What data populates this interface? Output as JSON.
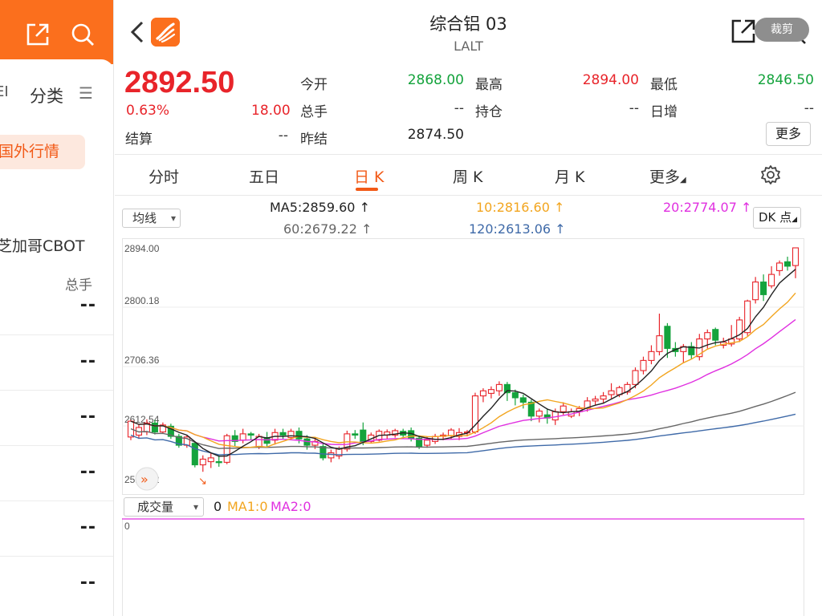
{
  "left": {
    "tab_cut": "EI",
    "tab_label": "分类",
    "menu_glyph": "☰",
    "pill_label": "国外行情",
    "market_name": "芝加哥CBOT",
    "col_header": "总手",
    "rows": [
      "--",
      "--",
      "--",
      "--",
      "--",
      "--"
    ]
  },
  "header": {
    "title": "综合铝 03",
    "subtitle": "LALT",
    "crop_label": "裁剪"
  },
  "quote": {
    "price": "2892.50",
    "change_pct": "0.63%",
    "change": "18.00",
    "settle_label": "结算",
    "settle_value": "--",
    "open_label": "今开",
    "open_value": "2868.00",
    "volume_label": "总手",
    "volume_value": "--",
    "prev_label": "昨结",
    "prev_value": "2874.50",
    "high_label": "最高",
    "high_value": "2894.00",
    "oi_label": "持仓",
    "oi_value": "--",
    "low_label": "最低",
    "low_value": "2846.50",
    "daily_inc_label": "日增",
    "daily_inc_value": "--",
    "more_label": "更多"
  },
  "tabs": [
    "分时",
    "五日",
    "日 K",
    "周 K",
    "月 K",
    "更多"
  ],
  "active_tab": "日 K",
  "indicators": {
    "selector": "均线",
    "ma5": "MA5:2859.60 ↑",
    "ma10": "10:2816.60 ↑",
    "ma20": "20:2774.07 ↑",
    "ma60": "60:2679.22 ↑",
    "ma120": "120:2613.06 ↑",
    "dk_label": "DK 点"
  },
  "colors": {
    "up": "#e8242a",
    "down": "#14a33c",
    "accent": "#f25a17",
    "ma5": "#222222",
    "ma10": "#f2a51f",
    "ma20": "#e030e0",
    "ma60": "#666666",
    "ma120": "#3f6aa8"
  },
  "volume": {
    "selector": "成交量",
    "value": "0",
    "ma1": "MA1:0",
    "ma2": "MA2:0",
    "axis_zero": "0"
  },
  "chart_data": {
    "type": "candlestick",
    "y_ticks": [
      "2894.00",
      "2800.18",
      "2706.36",
      "2612.54",
      "2518.72"
    ],
    "ylim": [
      2518.72,
      2894.0
    ],
    "candles": [
      [
        2595,
        2620,
        2590,
        2622
      ],
      [
        2598,
        2610,
        2592,
        2615
      ],
      [
        2603,
        2617,
        2598,
        2623
      ],
      [
        2617,
        2603,
        2599,
        2622
      ],
      [
        2603,
        2614,
        2600,
        2618
      ],
      [
        2612,
        2596,
        2592,
        2616
      ],
      [
        2596,
        2582,
        2578,
        2600
      ],
      [
        2582,
        2595,
        2578,
        2598
      ],
      [
        2585,
        2551,
        2547,
        2588
      ],
      [
        2551,
        2560,
        2540,
        2566
      ],
      [
        2556,
        2562,
        2546,
        2570
      ],
      [
        2556,
        2555,
        2548,
        2566
      ],
      [
        2555,
        2597,
        2552,
        2600
      ],
      [
        2597,
        2588,
        2580,
        2606
      ],
      [
        2590,
        2600,
        2585,
        2608
      ],
      [
        2600,
        2598,
        2590,
        2603
      ],
      [
        2580,
        2596,
        2576,
        2600
      ],
      [
        2594,
        2585,
        2580,
        2603
      ],
      [
        2590,
        2602,
        2583,
        2608
      ],
      [
        2602,
        2598,
        2592,
        2608
      ],
      [
        2594,
        2604,
        2590,
        2608
      ],
      [
        2604,
        2592,
        2585,
        2610
      ],
      [
        2592,
        2582,
        2575,
        2598
      ],
      [
        2582,
        2588,
        2576,
        2594
      ],
      [
        2580,
        2562,
        2558,
        2586
      ],
      [
        2562,
        2570,
        2555,
        2575
      ],
      [
        2565,
        2576,
        2560,
        2580
      ],
      [
        2576,
        2600,
        2572,
        2605
      ],
      [
        2600,
        2598,
        2592,
        2606
      ],
      [
        2606,
        2588,
        2582,
        2618
      ],
      [
        2588,
        2598,
        2585,
        2602
      ],
      [
        2590,
        2604,
        2588,
        2607
      ],
      [
        2598,
        2603,
        2592,
        2607
      ],
      [
        2598,
        2605,
        2594,
        2608
      ],
      [
        2604,
        2598,
        2592,
        2608
      ],
      [
        2605,
        2593,
        2588,
        2610
      ],
      [
        2593,
        2580,
        2576,
        2597
      ],
      [
        2582,
        2590,
        2578,
        2596
      ],
      [
        2588,
        2596,
        2584,
        2600
      ],
      [
        2596,
        2598,
        2590,
        2602
      ],
      [
        2597,
        2606,
        2592,
        2609
      ],
      [
        2596,
        2602,
        2590,
        2609
      ],
      [
        2602,
        2603,
        2596,
        2606
      ],
      [
        2603,
        2660,
        2600,
        2665
      ],
      [
        2660,
        2668,
        2650,
        2672
      ],
      [
        2664,
        2670,
        2656,
        2675
      ],
      [
        2668,
        2678,
        2660,
        2683
      ],
      [
        2678,
        2665,
        2652,
        2682
      ],
      [
        2665,
        2657,
        2645,
        2670
      ],
      [
        2657,
        2650,
        2640,
        2662
      ],
      [
        2650,
        2628,
        2620,
        2654
      ],
      [
        2628,
        2636,
        2618,
        2640
      ],
      [
        2630,
        2625,
        2616,
        2640
      ],
      [
        2622,
        2635,
        2614,
        2640
      ],
      [
        2635,
        2644,
        2630,
        2650
      ],
      [
        2628,
        2635,
        2625,
        2640
      ],
      [
        2635,
        2640,
        2628,
        2644
      ],
      [
        2640,
        2652,
        2635,
        2658
      ],
      [
        2652,
        2655,
        2646,
        2660
      ],
      [
        2655,
        2660,
        2648,
        2666
      ],
      [
        2662,
        2668,
        2656,
        2680
      ],
      [
        2662,
        2673,
        2658,
        2676
      ],
      [
        2666,
        2678,
        2662,
        2682
      ],
      [
        2678,
        2700,
        2672,
        2705
      ],
      [
        2700,
        2716,
        2694,
        2722
      ],
      [
        2716,
        2730,
        2710,
        2740
      ],
      [
        2730,
        2755,
        2724,
        2790
      ],
      [
        2770,
        2735,
        2720,
        2775
      ],
      [
        2735,
        2730,
        2722,
        2745
      ],
      [
        2730,
        2738,
        2712,
        2742
      ],
      [
        2738,
        2725,
        2718,
        2745
      ],
      [
        2722,
        2750,
        2716,
        2758
      ],
      [
        2750,
        2760,
        2735,
        2765
      ],
      [
        2765,
        2748,
        2740,
        2768
      ],
      [
        2740,
        2745,
        2735,
        2752
      ],
      [
        2742,
        2750,
        2738,
        2772
      ],
      [
        2750,
        2780,
        2745,
        2785
      ],
      [
        2760,
        2810,
        2755,
        2812
      ],
      [
        2812,
        2840,
        2806,
        2848
      ],
      [
        2840,
        2820,
        2810,
        2852
      ],
      [
        2834,
        2852,
        2830,
        2865
      ],
      [
        2858,
        2870,
        2850,
        2874
      ],
      [
        2872,
        2865,
        2858,
        2880
      ],
      [
        2866,
        2894,
        2846,
        2894
      ]
    ]
  }
}
